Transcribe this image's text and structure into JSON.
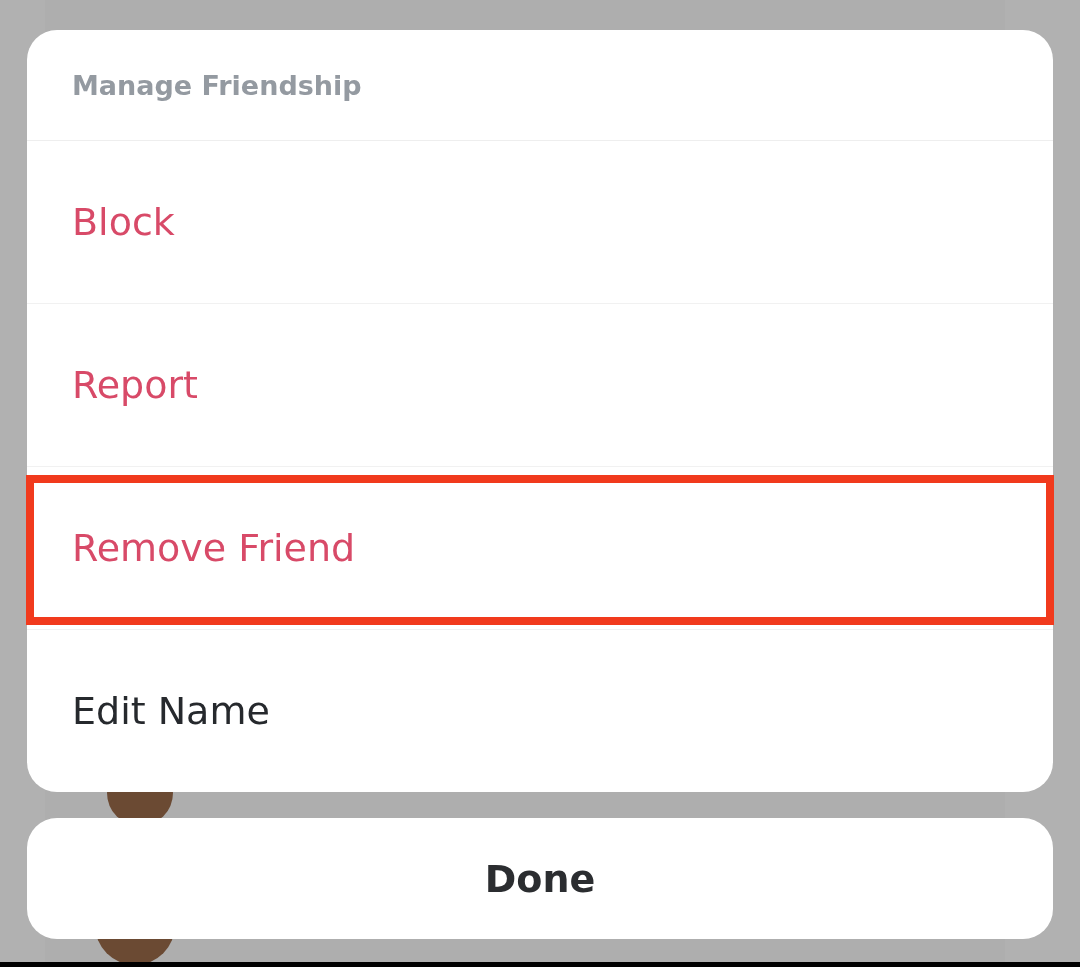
{
  "sheet": {
    "title": "Manage Friendship",
    "items": [
      {
        "label": "Block",
        "kind": "destructive",
        "highlighted": false
      },
      {
        "label": "Report",
        "kind": "destructive",
        "highlighted": false
      },
      {
        "label": "Remove Friend",
        "kind": "destructive",
        "highlighted": true
      },
      {
        "label": "Edit Name",
        "kind": "normal",
        "highlighted": false
      }
    ]
  },
  "done_button": {
    "label": "Done"
  }
}
